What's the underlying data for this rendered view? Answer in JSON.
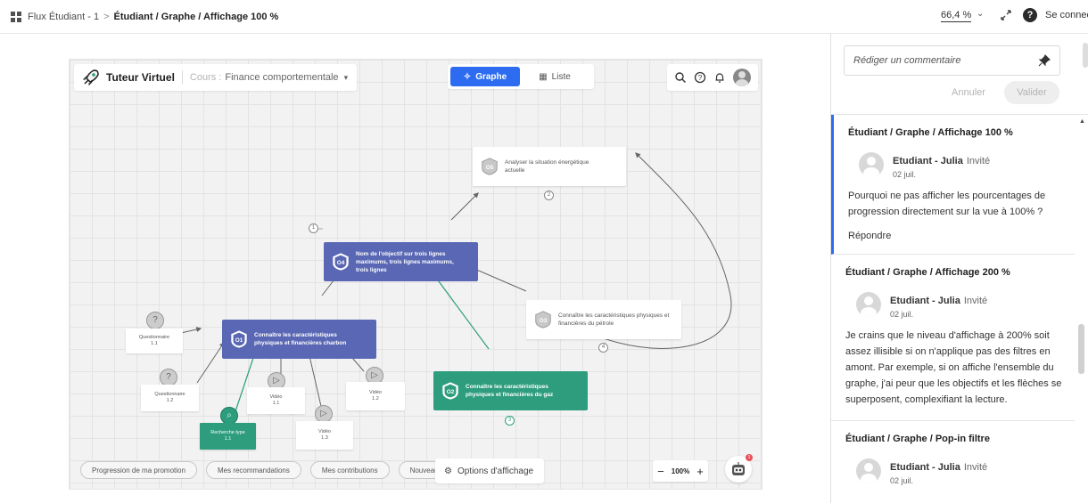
{
  "topbar": {
    "breadcrumb_root": "Flux Étudiant - 1",
    "breadcrumb_sep": ">",
    "breadcrumb_current": "Étudiant / Graphe / Affichage 100 %",
    "zoom": "66,4 %",
    "help": "?",
    "connect_label": "Se connecter"
  },
  "app": {
    "title": "Tuteur Virtuel",
    "course_prefix": "Cours :",
    "course_name": "Finance comportementale",
    "tabs": [
      {
        "label": "Graphe",
        "active": true
      },
      {
        "label": "Liste",
        "active": false
      }
    ],
    "nodes": {
      "o1": {
        "badge": "O1",
        "label": "Connaître les caractéristiques physiques et financières charbon"
      },
      "o2": {
        "badge": "O2",
        "label": "Connaître les caractéristiques physiques et financières du gaz"
      },
      "o3": {
        "badge": "O3",
        "label": "Connaître les caractéristiques physiques et financières du pétrole"
      },
      "o4": {
        "badge": "O4",
        "label": "Nom de l'objectif sur trois lignes maximums, trois lignes maximums, trois lignes"
      },
      "o5": {
        "badge": "O5",
        "label": "Analyser la situation énergétique actuelle"
      }
    },
    "resources": [
      {
        "type": "Questionnaire",
        "num": "1.1"
      },
      {
        "type": "Questionnaire",
        "num": "1.2"
      },
      {
        "type": "Recherche type",
        "num": "1.1"
      },
      {
        "type": "Vidéo",
        "num": "1.1"
      },
      {
        "type": "Vidéo",
        "num": "1.3"
      },
      {
        "type": "Vidéo",
        "num": "1.2"
      }
    ],
    "badges": [
      "1",
      "2",
      "3",
      "4"
    ],
    "footer_pills": [
      "Progression de ma promotion",
      "Mes recommandations",
      "Mes contributions",
      "Nouveautés"
    ],
    "options_label": "Options d'affichage",
    "zoom_minus": "−",
    "zoom_value": "100%",
    "zoom_plus": "+",
    "robot_notification": "1",
    "colors": {
      "accent": "#2d6cf0",
      "objective_blue": "#5967b4",
      "objective_green": "#2e9d7d"
    }
  },
  "panel": {
    "comment_placeholder": "Rédiger un commentaire",
    "cancel_label": "Annuler",
    "validate_label": "Valider",
    "threads": [
      {
        "title": "Étudiant / Graphe / Affichage 100 %",
        "author": "Etudiant - Julia",
        "role": "Invité",
        "date": "02 juil.",
        "body": "Pourquoi ne pas afficher les pourcentages de progression directement sur la vue à 100% ?",
        "reply_label": "Répondre"
      },
      {
        "title": "Étudiant / Graphe / Affichage 200 %",
        "author": "Etudiant - Julia",
        "role": "Invité",
        "date": "02 juil.",
        "body": "Je crains que le niveau d'affichage à 200% soit assez illisible si on n'applique pas des filtres en amont. Par exemple, si on affiche l'ensemble du graphe, j'ai peur que les objectifs et les flèches se superposent, complexifiant la lecture."
      },
      {
        "title": "Étudiant / Graphe / Pop-in filtre",
        "author": "Etudiant - Julia",
        "role": "Invité",
        "date": "02 juil."
      }
    ]
  }
}
